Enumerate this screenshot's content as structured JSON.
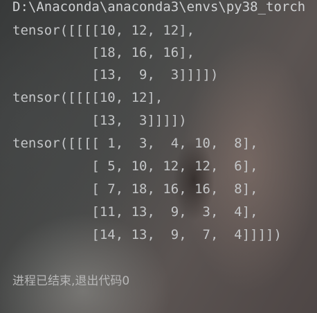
{
  "terminal": {
    "path": "D:\\Anaconda\\anaconda3\\envs\\py38_torch",
    "output_lines": [
      "tensor([[[[10, 12, 12],",
      "          [18, 16, 16],",
      "          [13,  9,  3]]]])",
      "tensor([[[[10, 12],",
      "          [13,  3]]]])",
      "tensor([[[[ 1,  3,  4, 10,  8],",
      "          [ 5, 10, 12, 12,  6],",
      "          [ 7, 18, 16, 16,  8],",
      "          [11, 13,  9,  3,  4],",
      "          [14, 13,  9,  7,  4]]]])"
    ],
    "exit_message": "进程已结束,退出代码0"
  }
}
